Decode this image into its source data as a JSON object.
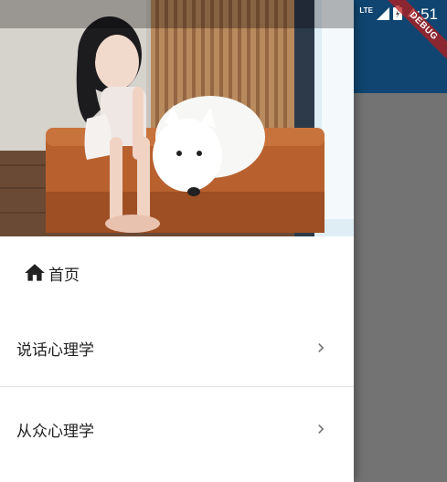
{
  "status_bar": {
    "network_label": "LTE",
    "time": "4:51"
  },
  "debug_banner": {
    "label": "DEBUG",
    "color": "#b71c1c"
  },
  "app": {
    "app_bar_color": "#2196f3"
  },
  "drawer": {
    "header_image": "woman-with-white-dog-photo",
    "home": {
      "icon": "home-icon",
      "label": "首页"
    },
    "items": [
      {
        "label": "说话心理学",
        "icon": "chevron-right-icon"
      },
      {
        "label": "从众心理学",
        "icon": "chevron-right-icon"
      }
    ]
  }
}
